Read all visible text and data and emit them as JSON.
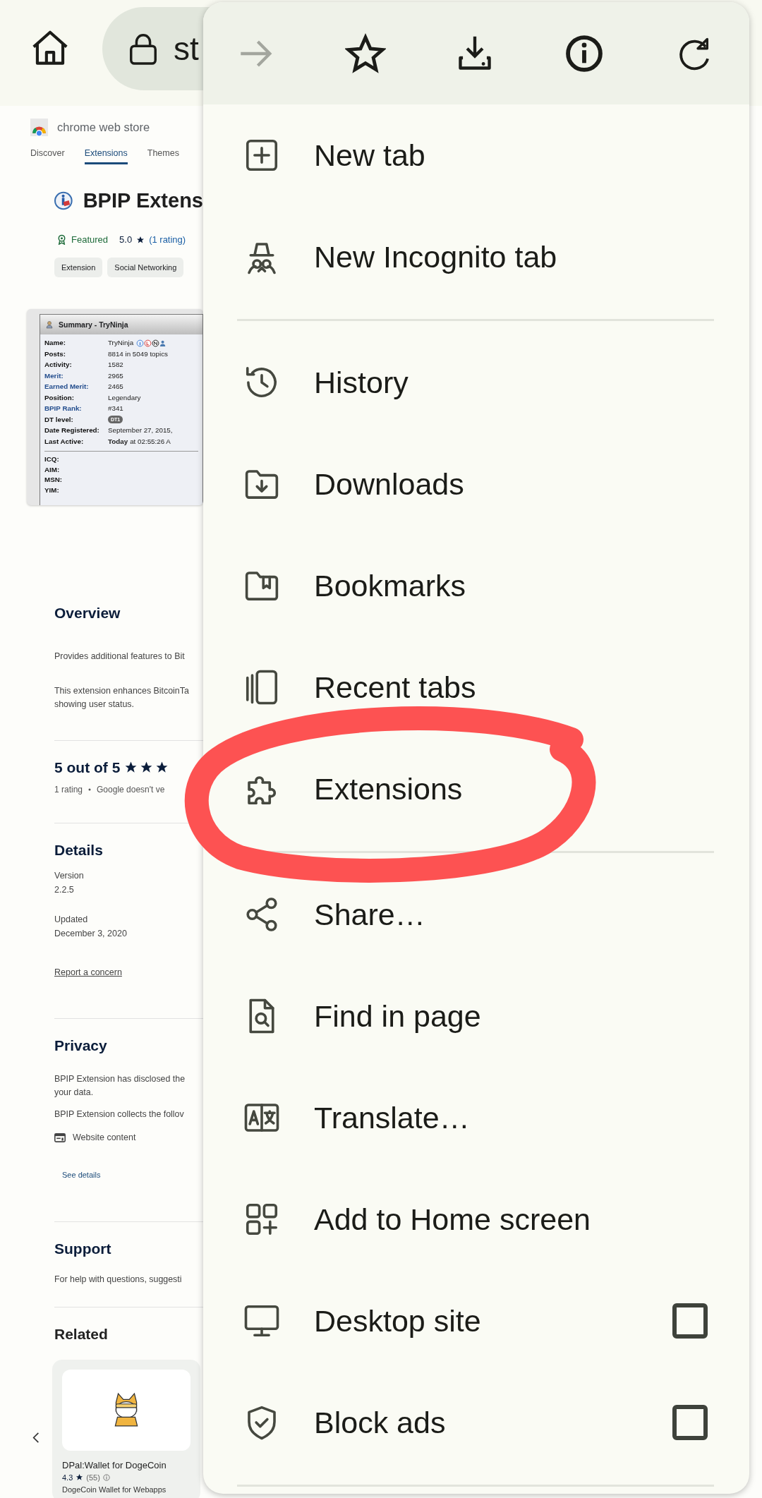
{
  "top_bar": {
    "address": "st"
  },
  "store": {
    "brand": "chrome web store",
    "tabs": [
      {
        "label": "Discover",
        "selected": false
      },
      {
        "label": "Extensions",
        "selected": true
      },
      {
        "label": "Themes",
        "selected": false
      }
    ]
  },
  "extension": {
    "title": "BPIP Extens",
    "featured": "Featured",
    "rating": "5.0",
    "rating_link": "(1 rating)",
    "chips": [
      "Extension",
      "Social Networking"
    ]
  },
  "screenshot": {
    "title": "Summary - TryNinja",
    "rows": [
      {
        "label": "Name:",
        "value": "TryNinja",
        "kind": "name",
        "link": false
      },
      {
        "label": "Posts:",
        "value": "8814 in 5049 topics",
        "kind": "text",
        "link": false
      },
      {
        "label": "Activity:",
        "value": "1582",
        "kind": "text",
        "link": false
      },
      {
        "label": "Merit:",
        "value": "2965",
        "kind": "text",
        "link": true
      },
      {
        "label": "Earned Merit:",
        "value": "2465",
        "kind": "text",
        "link": true
      },
      {
        "label": "Position:",
        "value": "Legendary",
        "kind": "text",
        "link": false
      },
      {
        "label": "BPIP Rank:",
        "value": "#341",
        "kind": "text",
        "link": true
      },
      {
        "label": "DT level:",
        "value": "DT1",
        "kind": "badge",
        "link": false
      },
      {
        "label": "Date Registered:",
        "value": "September 27, 2015,",
        "kind": "text",
        "link": false
      },
      {
        "label": "Last Active:",
        "value": "**Today** at 02:55:26 A",
        "kind": "rich",
        "link": false
      }
    ],
    "contacts": [
      "ICQ:",
      "AIM:",
      "MSN:",
      "YIM:"
    ]
  },
  "overview": {
    "heading": "Overview",
    "paragraphs": [
      "Provides additional features to Bit",
      "This extension enhances BitcoinTa showing user status."
    ]
  },
  "rating": {
    "heading": "5 out of 5",
    "stars": 3,
    "note": "1 rating",
    "disclaimer": "Google doesn't ve"
  },
  "details": {
    "heading": "Details",
    "fields": [
      {
        "label": "Version",
        "value": "2.2.5"
      },
      {
        "label": "Updated",
        "value": "December 3, 2020"
      }
    ],
    "report_link": "Report a concern"
  },
  "privacy": {
    "heading": "Privacy",
    "paragraphs": [
      "BPIP Extension has disclosed the your data.",
      "BPIP Extension collects the follov"
    ],
    "data_item": "Website content",
    "details_link": "See details"
  },
  "support": {
    "heading": "Support",
    "text": "For help with questions, suggesti"
  },
  "related": {
    "heading": "Related",
    "cards": [
      {
        "name": "DPal:Wallet for DogeCoin",
        "rating": "4.3",
        "count": "(55)",
        "description": "DogeCoin Wallet for Webapps"
      }
    ]
  },
  "menu": {
    "toolbar": {
      "forward_disabled": true
    },
    "sections": [
      {
        "items": [
          {
            "label": "New tab",
            "kind": "action"
          },
          {
            "label": "New Incognito tab",
            "kind": "action"
          }
        ]
      },
      {
        "items": [
          {
            "label": "History",
            "kind": "action"
          },
          {
            "label": "Downloads",
            "kind": "action"
          },
          {
            "label": "Bookmarks",
            "kind": "action"
          },
          {
            "label": "Recent tabs",
            "kind": "action"
          },
          {
            "label": "Extensions",
            "kind": "action"
          }
        ]
      },
      {
        "items": [
          {
            "label": "Share…",
            "kind": "action"
          },
          {
            "label": "Find in page",
            "kind": "action"
          },
          {
            "label": "Translate…",
            "kind": "action"
          },
          {
            "label": "Add to Home screen",
            "kind": "action"
          },
          {
            "label": "Desktop site",
            "kind": "checkbox",
            "checked": false
          },
          {
            "label": "Block ads",
            "kind": "checkbox",
            "checked": false
          }
        ]
      }
    ]
  }
}
